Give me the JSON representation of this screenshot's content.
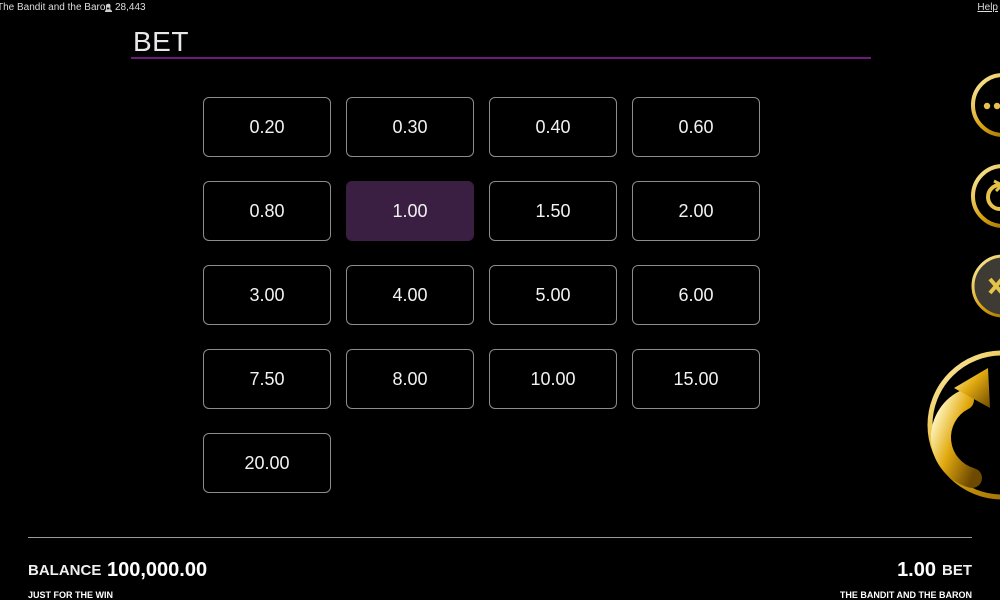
{
  "topbar": {
    "game_title": "The Bandit and the Baron",
    "player_count": "28,443",
    "help_label": "Help"
  },
  "bet_panel": {
    "title": "BET",
    "options": [
      "0.20",
      "0.30",
      "0.40",
      "0.60",
      "0.80",
      "1.00",
      "1.50",
      "2.00",
      "3.00",
      "4.00",
      "5.00",
      "6.00",
      "7.50",
      "8.00",
      "10.00",
      "15.00",
      "20.00"
    ],
    "selected": "1.00"
  },
  "footer": {
    "balance_label": "BALANCE",
    "balance_value": "100,000.00",
    "left_subtitle": "JUST FOR THE WIN",
    "bet_value": "1.00",
    "bet_label": "BET",
    "right_subtitle": "THE BANDIT AND THE BARON"
  },
  "colors": {
    "accent": "#6e1a7e",
    "selected_bg": "#3a1f42",
    "gold": "#e7b81a"
  },
  "side_buttons": [
    "menu-icon",
    "autoplay-icon",
    "close-icon",
    "spin-icon"
  ]
}
